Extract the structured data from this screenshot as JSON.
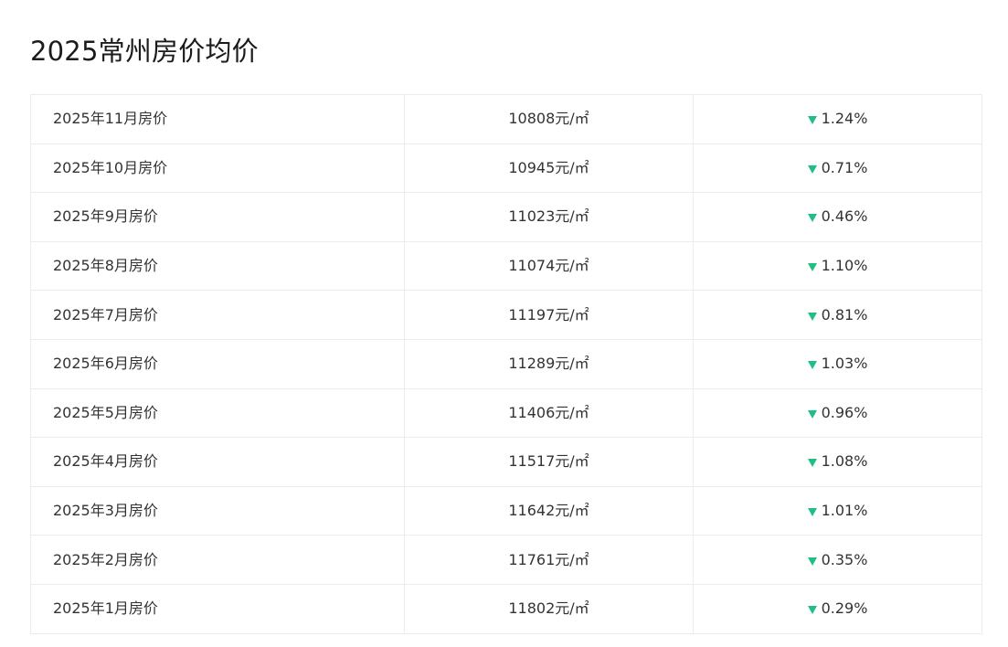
{
  "page": {
    "title": "2025常州房价均价"
  },
  "colors": {
    "down_arrow": "#1fbf83",
    "border": "#ececec",
    "text": "#333333"
  },
  "rows": [
    {
      "month": "2025年11月房价",
      "price": "10808元/㎡",
      "trend_icon": "down-arrow-icon",
      "change": "1.24%"
    },
    {
      "month": "2025年10月房价",
      "price": "10945元/㎡",
      "trend_icon": "down-arrow-icon",
      "change": "0.71%"
    },
    {
      "month": "2025年9月房价",
      "price": "11023元/㎡",
      "trend_icon": "down-arrow-icon",
      "change": "0.46%"
    },
    {
      "month": "2025年8月房价",
      "price": "11074元/㎡",
      "trend_icon": "down-arrow-icon",
      "change": "1.10%"
    },
    {
      "month": "2025年7月房价",
      "price": "11197元/㎡",
      "trend_icon": "down-arrow-icon",
      "change": "0.81%"
    },
    {
      "month": "2025年6月房价",
      "price": "11289元/㎡",
      "trend_icon": "down-arrow-icon",
      "change": "1.03%"
    },
    {
      "month": "2025年5月房价",
      "price": "11406元/㎡",
      "trend_icon": "down-arrow-icon",
      "change": "0.96%"
    },
    {
      "month": "2025年4月房价",
      "price": "11517元/㎡",
      "trend_icon": "down-arrow-icon",
      "change": "1.08%"
    },
    {
      "month": "2025年3月房价",
      "price": "11642元/㎡",
      "trend_icon": "down-arrow-icon",
      "change": "1.01%"
    },
    {
      "month": "2025年2月房价",
      "price": "11761元/㎡",
      "trend_icon": "down-arrow-icon",
      "change": "0.35%"
    },
    {
      "month": "2025年1月房价",
      "price": "11802元/㎡",
      "trend_icon": "down-arrow-icon",
      "change": "0.29%"
    }
  ]
}
